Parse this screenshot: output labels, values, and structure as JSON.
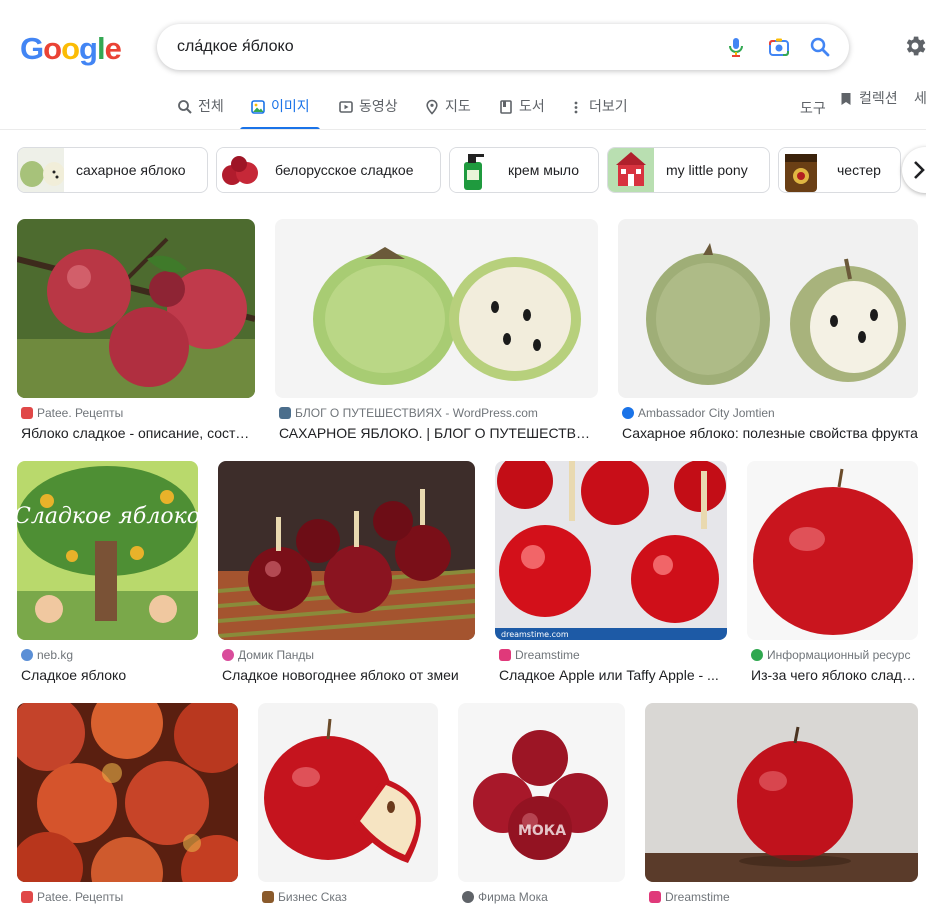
{
  "header": {
    "logo_letters": [
      {
        "ch": "G",
        "color": "#4285F4"
      },
      {
        "ch": "o",
        "color": "#EA4335"
      },
      {
        "ch": "o",
        "color": "#FBBC05"
      },
      {
        "ch": "g",
        "color": "#4285F4"
      },
      {
        "ch": "l",
        "color": "#34A853"
      },
      {
        "ch": "e",
        "color": "#EA4335"
      }
    ],
    "search_value": "сла́дкое я́блоко",
    "icons": [
      "mic-icon",
      "camera-icon",
      "search-icon",
      "gear-icon"
    ]
  },
  "tabs": [
    {
      "label": "전체",
      "icon": "search-icon",
      "active": false
    },
    {
      "label": "이미지",
      "icon": "image-icon",
      "active": true
    },
    {
      "label": "동영상",
      "icon": "video-icon",
      "active": false
    },
    {
      "label": "지도",
      "icon": "map-pin-icon",
      "active": false
    },
    {
      "label": "도서",
      "icon": "book-icon",
      "active": false
    },
    {
      "label": "더보기",
      "icon": "more-vert-icon",
      "active": false
    }
  ],
  "tools_label": "도구",
  "collection_label": "컬렉션",
  "cut_label": "세",
  "chips": [
    {
      "label": "сахарное яблоко"
    },
    {
      "label": "белорусское сладкое"
    },
    {
      "label": "крем мыло"
    },
    {
      "label": "my little pony"
    },
    {
      "label": "честер"
    }
  ],
  "results": [
    {
      "source": "Patee. Рецепты",
      "title": "Яблоко сладкое - описание, состав, калорийность..."
    },
    {
      "source": "БЛОГ О ПУТЕШЕСТВИЯХ - WordPress.com",
      "title": "САХАРНОЕ ЯБЛОКО. | БЛОГ О ПУТЕШЕСТВИЯХ"
    },
    {
      "source": "Ambassador City Jomtien",
      "title": "Сахарное яблоко: полезные свойства фрукта"
    },
    {
      "source": "neb.kg",
      "title": "Сладкое яблоко"
    },
    {
      "source": "Домик Панды",
      "title": "Сладкое новогоднее яблоко от змеи"
    },
    {
      "source": "Dreamstime",
      "title": "Сладкое Apple или Taffy Apple - ..."
    },
    {
      "source": "Информационный ресурс",
      "title": "Из-за чего яблоко сладкое"
    },
    {
      "source": "Patee. Рецепты",
      "title": ""
    },
    {
      "source": "Бизнес Сказ",
      "title": ""
    },
    {
      "source": "Фирма Мока",
      "title": ""
    },
    {
      "source": "Dreamstime",
      "title": ""
    }
  ],
  "image_texts": {
    "book_title": "Сладкое яблоко",
    "watermark_dreamstime": "dreamstime.com",
    "watermark_moka": "МОКА"
  }
}
